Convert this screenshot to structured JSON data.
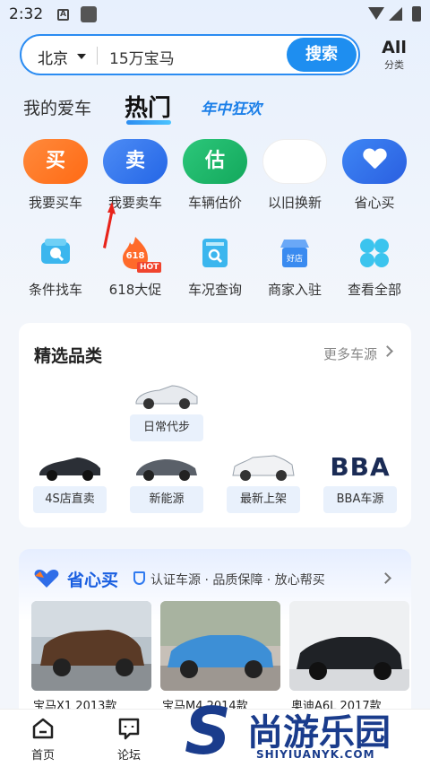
{
  "status_bar": {
    "time": "2:32"
  },
  "search": {
    "city": "北京",
    "query": "15万宝马",
    "button": "搜索"
  },
  "category": {
    "big": "All",
    "small": "分类"
  },
  "tabs": [
    {
      "label": "我的爱车"
    },
    {
      "label": "热门"
    },
    {
      "label": "年中狂欢"
    }
  ],
  "quick_actions": [
    {
      "icon_text": "买",
      "label": "我要买车",
      "color": "#ff7a24"
    },
    {
      "icon_text": "卖",
      "label": "我要卖车",
      "color": "#2f74ec"
    },
    {
      "icon_text": "估",
      "label": "车辆估价",
      "color": "#1fb86a"
    },
    {
      "icon_text": "",
      "label": "以旧换新",
      "color": "#ffffff"
    },
    {
      "icon_text": "",
      "label": "省心买",
      "icon": "heart-icon",
      "color": "#2f6de8"
    }
  ],
  "services": [
    {
      "label": "条件找车",
      "icon": "car-search-icon"
    },
    {
      "label": "618大促",
      "icon": "flame-icon",
      "badge": "HOT",
      "icon_text": "618"
    },
    {
      "label": "车况查询",
      "icon": "document-search-icon"
    },
    {
      "label": "商家入驻",
      "icon": "shop-icon",
      "icon_text": "好店"
    },
    {
      "label": "查看全部",
      "icon": "grid-icon"
    }
  ],
  "selection": {
    "title": "精选品类",
    "more": "更多车源",
    "categories": [
      {
        "label": "日常代步"
      },
      {
        "label": "4S店直卖"
      },
      {
        "label": "新能源"
      },
      {
        "label": "最新上架"
      },
      {
        "label": "BBA车源",
        "logo_text": "BBA"
      }
    ]
  },
  "worry_free": {
    "brand": "省心买",
    "slogan": "认证车源 · 品质保障 · 放心帮买",
    "listings": [
      {
        "title": "宝马X1 2013款"
      },
      {
        "title": "宝马M4 2014款"
      },
      {
        "title": "奥迪A6L 2017款"
      }
    ]
  },
  "bottom_nav": [
    {
      "label": "首页",
      "icon": "home-icon"
    },
    {
      "label": "论坛",
      "icon": "forum-icon"
    }
  ],
  "watermark": {
    "cn": "尚游乐园",
    "en": "SHIYIUANYK.COM"
  },
  "colors": {
    "accent": "#1e8ef0",
    "brand_dark": "#1a3c8c"
  }
}
